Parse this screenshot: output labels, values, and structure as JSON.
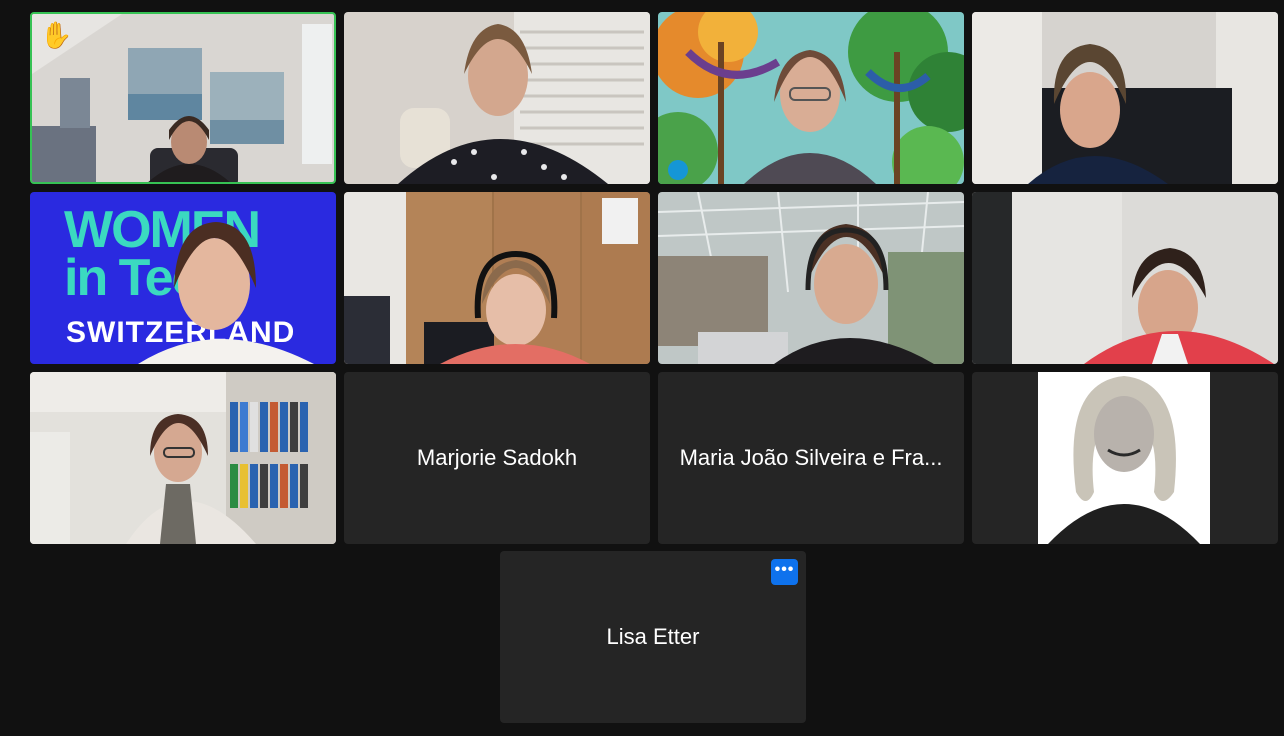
{
  "meeting": {
    "participants": [
      {
        "id": "p1",
        "name": "",
        "video": true,
        "hand_raised": true,
        "active_speaker": true
      },
      {
        "id": "p2",
        "name": "",
        "video": true
      },
      {
        "id": "p3",
        "name": "",
        "video": true
      },
      {
        "id": "p4",
        "name": "",
        "video": true
      },
      {
        "id": "p5",
        "name": "",
        "video": true,
        "background_text": [
          "WOMEN",
          "in Tech",
          "SWITZERLAND"
        ]
      },
      {
        "id": "p6",
        "name": "",
        "video": true
      },
      {
        "id": "p7",
        "name": "",
        "video": true
      },
      {
        "id": "p8",
        "name": "",
        "video": true
      },
      {
        "id": "p9",
        "name": "",
        "video": true
      },
      {
        "id": "p10",
        "name": "Marjorie Sadokh",
        "video": false
      },
      {
        "id": "p11",
        "name": "Maria João Silveira e Fra...",
        "video": false
      },
      {
        "id": "p12",
        "name": "",
        "video": false,
        "profile_photo": true
      },
      {
        "id": "p13",
        "name": "Lisa Etter",
        "video": false,
        "more_button": "•••"
      }
    ],
    "icons": {
      "hand_raised": "raised-hand-icon",
      "more": "more-options-icon"
    },
    "colors": {
      "background": "#111111",
      "tile": "#252525",
      "active_border": "#36c254",
      "more_button": "#0e72ed",
      "logo_teal": "#3bd9c0",
      "logo_blue": "#2a2ae0"
    }
  }
}
